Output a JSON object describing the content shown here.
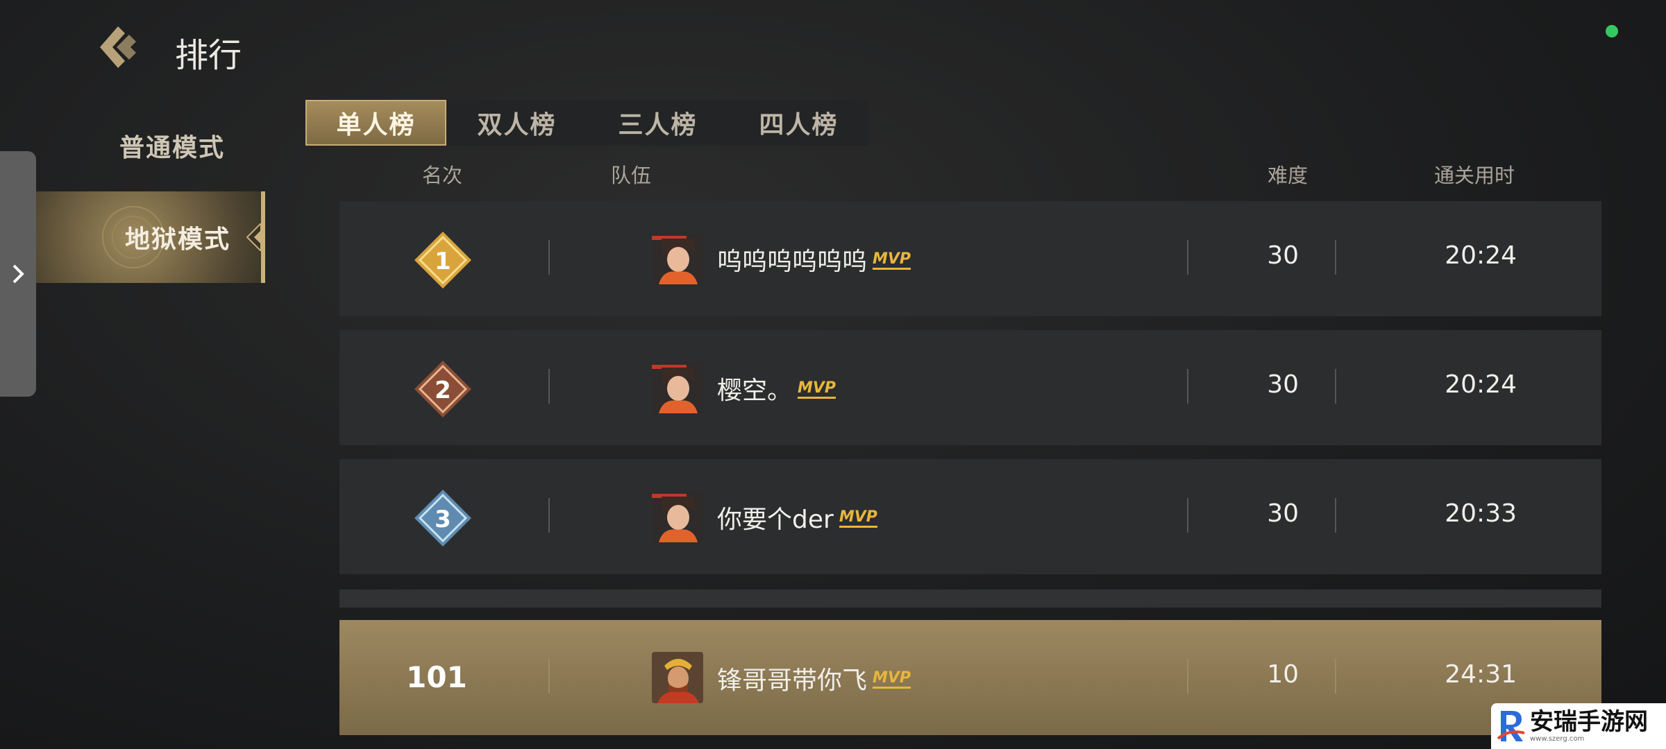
{
  "header": {
    "title": "排行",
    "back_icon": "back-chevron-icon"
  },
  "modes": [
    {
      "label": "普通模式",
      "selected": false
    },
    {
      "label": "地狱模式",
      "selected": true
    }
  ],
  "tabs": [
    {
      "label": "单人榜",
      "active": true
    },
    {
      "label": "双人榜",
      "active": false
    },
    {
      "label": "三人榜",
      "active": false
    },
    {
      "label": "四人榜",
      "active": false
    }
  ],
  "columns": {
    "rank": "名次",
    "team": "队伍",
    "difficulty": "难度",
    "time": "通关用时"
  },
  "rows": [
    {
      "rank": "1",
      "name": "呜呜呜呜呜呜",
      "mvp": "MVP",
      "difficulty": "30",
      "time": "20:24",
      "badge_color": "#d9a43c"
    },
    {
      "rank": "2",
      "name": "樱空。",
      "mvp": "MVP",
      "difficulty": "30",
      "time": "20:24",
      "badge_color": "#8a4e36"
    },
    {
      "rank": "3",
      "name": "你要个der",
      "mvp": "MVP",
      "difficulty": "30",
      "time": "20:33",
      "badge_color": "#5f8bb0"
    }
  ],
  "my_row": {
    "rank": "101",
    "name": "锋哥哥带你飞",
    "mvp": "MVP",
    "difficulty": "10",
    "time": "24:31"
  },
  "watermark": {
    "title": "安瑞手游网",
    "url": "www.szerg.com"
  },
  "colors": {
    "gold": "#c9b17b",
    "status_dot": "#35c860"
  }
}
